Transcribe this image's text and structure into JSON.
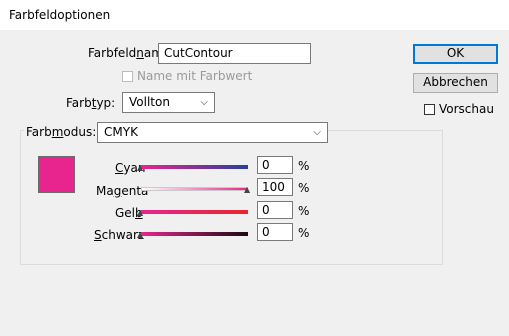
{
  "window": {
    "title": "Farbfeldoptionen"
  },
  "form": {
    "name_label_pre": "Farbfeld",
    "name_label_u": "n",
    "name_label_post": "ame:",
    "name_value": "CutContour",
    "name_with_color_value": "Name mit Farbwert",
    "type_label_pre": "Farb",
    "type_label_u": "t",
    "type_label_post": "yp:",
    "type_value": "Vollton",
    "mode_label_pre": "Farb",
    "mode_label_u": "m",
    "mode_label_post": "odus:",
    "mode_value": "CMYK"
  },
  "buttons": {
    "ok": "OK",
    "cancel": "Abbrechen",
    "preview": "Vorschau"
  },
  "swatch": {
    "color": "#e8258e"
  },
  "channels": [
    {
      "u": "C",
      "rest": "yan",
      "value": "0",
      "percent": 0,
      "unit": "%"
    },
    {
      "pre": "Ma",
      "u": "g",
      "post": "enta",
      "value": "100",
      "percent": 100,
      "unit": "%"
    },
    {
      "pre": "Gel",
      "u": "b",
      "post": "",
      "value": "0",
      "percent": 0,
      "unit": "%"
    },
    {
      "u": "S",
      "rest": "chwarz",
      "value": "0",
      "percent": 0,
      "unit": "%"
    }
  ],
  "colors": {
    "cyan_end": "#283f9c",
    "magenta_start": "#ffffff",
    "magenta_end": "#e8258e",
    "yellow_end": "#e8262e",
    "black_end": "#1a0a12",
    "default_button_border": "#0078d7"
  },
  "icons": {
    "dropdown": "chevron-down-icon",
    "slider_thumb": "triangle-up-icon"
  }
}
